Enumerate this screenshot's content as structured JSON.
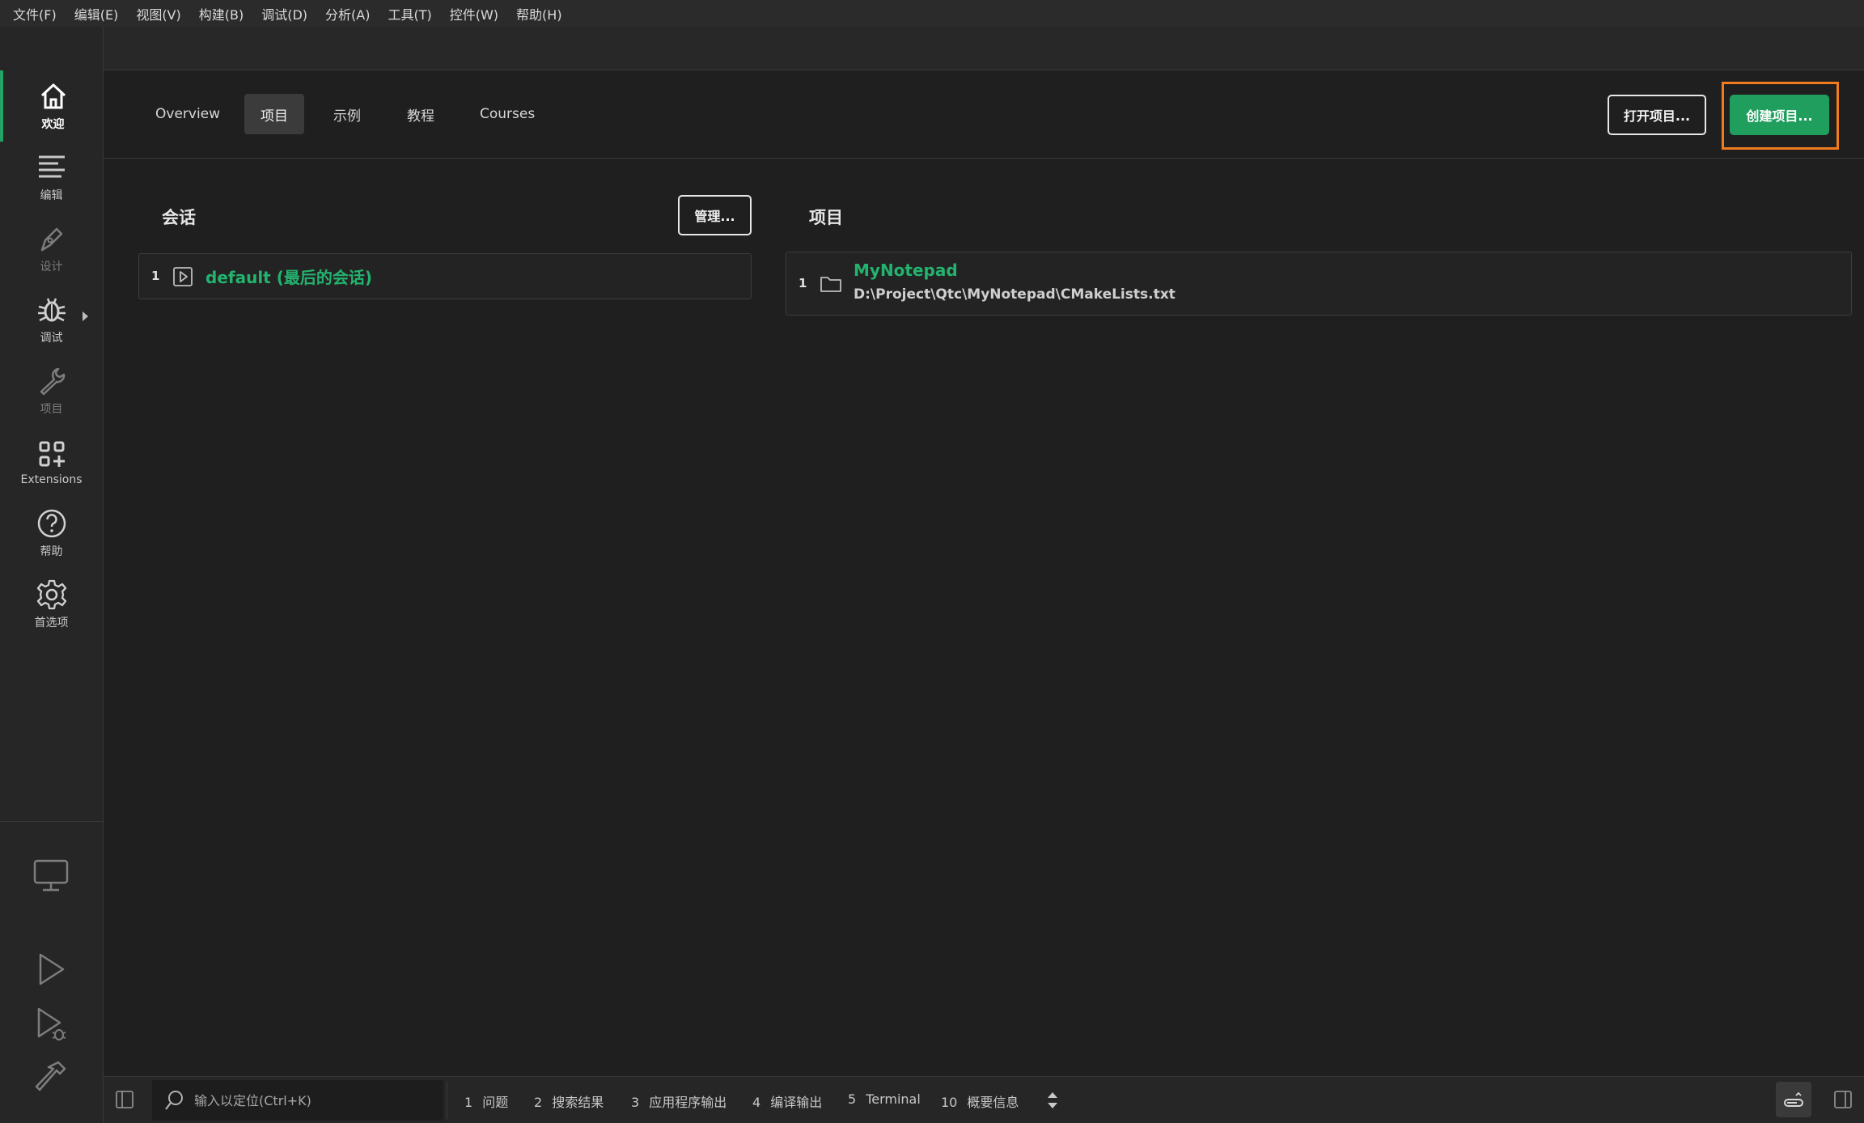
{
  "menu": [
    "文件(F)",
    "编辑(E)",
    "视图(V)",
    "构建(B)",
    "调试(D)",
    "分析(A)",
    "工具(T)",
    "控件(W)",
    "帮助(H)"
  ],
  "sidebar": {
    "modes": [
      {
        "label": "欢迎",
        "icon": "home-icon",
        "state": "active"
      },
      {
        "label": "编辑",
        "icon": "edit-lines-icon",
        "state": "normal"
      },
      {
        "label": "设计",
        "icon": "pen-icon",
        "state": "disabled"
      },
      {
        "label": "调试",
        "icon": "bug-icon",
        "state": "normal"
      },
      {
        "label": "项目",
        "icon": "wrench-icon",
        "state": "disabled"
      },
      {
        "label": "Extensions",
        "icon": "extensions-icon",
        "state": "normal"
      },
      {
        "label": "帮助",
        "icon": "help-icon",
        "state": "normal"
      },
      {
        "label": "首选项",
        "icon": "gear-icon",
        "state": "normal"
      }
    ],
    "tools": [
      "monitor-icon",
      "run-icon",
      "debug-run-icon",
      "build-hammer-icon"
    ]
  },
  "welcome": {
    "tabs": [
      "Overview",
      "项目",
      "示例",
      "教程",
      "Courses"
    ],
    "active_tab": "项目",
    "open_project_label": "打开项目...",
    "create_project_label": "创建项目..."
  },
  "sessions": {
    "title": "会话",
    "manage_label": "管理...",
    "items": [
      {
        "index": "1",
        "name": "default (最后的会话)"
      }
    ]
  },
  "projects": {
    "title": "项目",
    "items": [
      {
        "index": "1",
        "name": "MyNotepad",
        "path": "D:\\Project\\Qtc\\MyNotepad\\CMakeLists.txt"
      }
    ]
  },
  "statusbar": {
    "locator_placeholder": "输入以定位(Ctrl+K)",
    "panes": [
      {
        "n": "1",
        "label": "问题"
      },
      {
        "n": "2",
        "label": "搜索结果"
      },
      {
        "n": "3",
        "label": "应用程序输出"
      },
      {
        "n": "4",
        "label": "编译输出"
      },
      {
        "n": "5",
        "label": "Terminal"
      },
      {
        "n": "10",
        "label": "概要信息"
      }
    ]
  },
  "colors": {
    "accent": "#23b36e",
    "button_green": "#1f9e5e",
    "highlight": "#f07c1e"
  }
}
